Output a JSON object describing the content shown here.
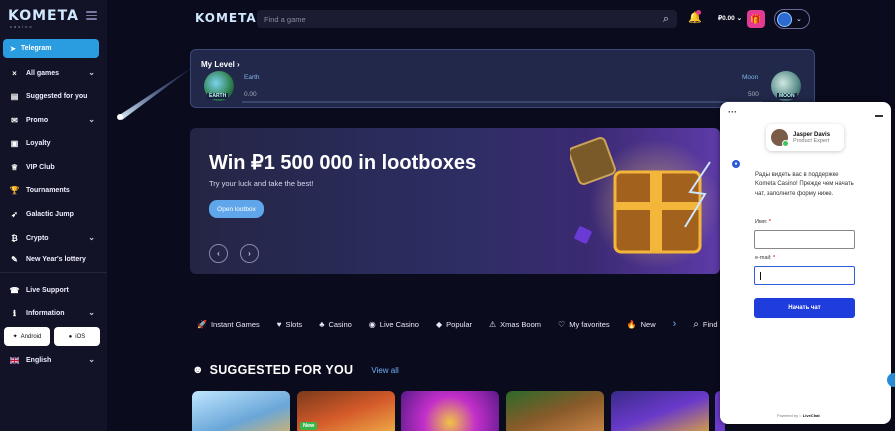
{
  "sidebar": {
    "logo": "KOMETA",
    "logo_sub": "casino",
    "telegram": "Telegram",
    "items": [
      {
        "label": "All games",
        "icon": "×",
        "chevron": "⌄"
      },
      {
        "label": "Suggested for you",
        "icon": "▤"
      },
      {
        "label": "Promo",
        "icon": "✉",
        "chevron": "⌄"
      },
      {
        "label": "Loyalty",
        "icon": "▣"
      },
      {
        "label": "VIP Club",
        "icon": "♕"
      },
      {
        "label": "Tournaments",
        "icon": "🏆"
      },
      {
        "label": "Galactic Jump",
        "icon": "➶"
      },
      {
        "label": "Crypto",
        "icon": "₿",
        "chevron": "⌄"
      },
      {
        "label": "New Year's lottery",
        "icon": "✎"
      },
      {
        "label": "Live Support",
        "icon": "☎"
      },
      {
        "label": "Information",
        "icon": "ℹ",
        "chevron": "⌄"
      }
    ],
    "android": "Android",
    "ios": "iOS",
    "language": "English"
  },
  "header": {
    "logo": "KOMETA",
    "search_placeholder": "Find a game",
    "balance": "₽0.00"
  },
  "level": {
    "title": "My Level",
    "start_name": "Earth",
    "start_badge": "EARTH",
    "start_value": "0.00",
    "end_name": "Moon",
    "end_badge": "MOON",
    "end_value": "500",
    "progress": 0
  },
  "banner": {
    "title": "Win ₽1 500 000 in lootboxes",
    "subtitle": "Try your luck and take the best!",
    "button": "Open lootbox"
  },
  "categories": [
    {
      "label": "Instant Games",
      "icon": "🚀"
    },
    {
      "label": "Slots",
      "icon": "♥"
    },
    {
      "label": "Casino",
      "icon": "♣"
    },
    {
      "label": "Live Casino",
      "icon": "◉"
    },
    {
      "label": "Popular",
      "icon": "◆"
    },
    {
      "label": "Xmas Boom",
      "icon": "⚠"
    },
    {
      "label": "My favorites",
      "icon": "♡"
    },
    {
      "label": "New",
      "icon": "🔥"
    },
    {
      "label": "Find a g",
      "icon": "⌕"
    }
  ],
  "suggested": {
    "title": "SUGGESTED FOR YOU",
    "view_all": "View all",
    "new_badge": "New"
  },
  "chat": {
    "agent_name": "Jasper Davis",
    "agent_role": "Product Expert",
    "message": "Рады видеть вас в поддержке Kometa Casino! Прежде чем начать чат, заполните форму ниже.",
    "name_label": "Имя:",
    "email_label": "e-mail:",
    "submit": "Начать чат",
    "powered_prefix": "Powered by",
    "powered_brand": "LiveChat"
  },
  "colors": {
    "accent": "#2a9ce0",
    "gift": "#e33a93",
    "chat_button": "#1f3ddc"
  }
}
